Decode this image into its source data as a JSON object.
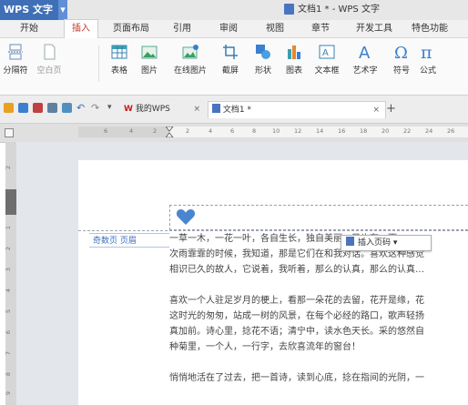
{
  "app": {
    "name": "WPS 文字",
    "doc_title": "文档1 * - WPS 文字"
  },
  "menu": [
    "开始",
    "插入",
    "页面布局",
    "引用",
    "审阅",
    "视图",
    "章节",
    "开发工具",
    "特色功能"
  ],
  "ribbon": [
    "分隔符",
    "空白页",
    "表格",
    "图片",
    "在线图片",
    "截屏",
    "形状",
    "图表",
    "文本框",
    "艺术字",
    "符号",
    "公式"
  ],
  "tabs": {
    "wps": "我的WPS",
    "doc": "文档1 *",
    "close": "×",
    "add": "+"
  },
  "ruler_h": [
    "6",
    "4",
    "2",
    "2",
    "4",
    "6",
    "8",
    "10",
    "12",
    "14",
    "16",
    "18",
    "20",
    "22",
    "24",
    "26"
  ],
  "ruler_v": [
    "2",
    "1",
    "1",
    "2",
    "3",
    "4",
    "5",
    "6",
    "7",
    "8",
    "9",
    "10",
    "11"
  ],
  "header": {
    "label": "奇数页 页眉",
    "insert_page_btn": "插入页码 ▾"
  },
  "body_lines": [
    "一草一木，一花一叶，各自生长，独自美丽，风也有，雨",
    "次雨霏霏的时候，我知道，那是它们在和我对话。喜欢这种感觉",
    "相识已久的故人，它说着，我听着，那么的认真，那么的认真…",
    "",
    "喜欢一个人驻足岁月的梗上，看那一朵花的去留，花开是缘，花",
    "这时光的匆匆，站成一树的风景，在每个必经的路口，歌声轻扬",
    "真加前。诗心里，捻花不语；清宁中，读水色天长。采的悠然自",
    "种菊里，一个人，一行字，去欣喜流年的窗台！",
    "",
    "悄悄地活在了过去，把一首诗，读到心底，捻在指间的光阴，一"
  ],
  "colors": {
    "accent": "#3f6fb6",
    "heart": "#4a86d0",
    "active_tab": "#c0392b"
  }
}
